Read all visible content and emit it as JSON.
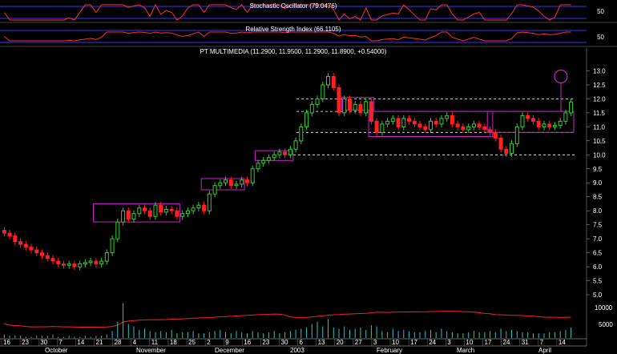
{
  "panels": {
    "stochastic": {
      "title": "Stochastic Oscillator (79.0476)",
      "label": "50",
      "line_color": "#ff3030",
      "band_color": "#3333ff"
    },
    "rsi": {
      "title": "Relative Strength Index (66.1105)",
      "label": "50",
      "line_color": "#ff3030",
      "band_color": "#3333ff"
    }
  },
  "chart_data": {
    "type": "candlestick",
    "title": "PT MULTIMEDIA (11.2900, 11.9500, 11.2900, 11.8900, +0.54000)",
    "ylim": [
      5.0,
      13.3
    ],
    "yticks": [
      "13.0",
      "12.5",
      "12.0",
      "11.5",
      "11.0",
      "10.5",
      "10.0",
      "9.5",
      "9.0",
      "8.5",
      "8.0",
      "7.5",
      "7.0",
      "6.5",
      "6.0",
      "5.5",
      "5.0"
    ],
    "colors": {
      "up": "#30d030",
      "down": "#ff2020",
      "grid": "#ffffff",
      "box": "#d020d0",
      "volume": "#20c8c8",
      "volume_ma": "#ff2020"
    },
    "closes": [
      7.2,
      7.1,
      6.9,
      6.8,
      6.7,
      6.6,
      6.5,
      6.4,
      6.3,
      6.2,
      6.1,
      6.05,
      6.1,
      6.0,
      6.1,
      6.15,
      6.2,
      6.1,
      6.2,
      6.5,
      7.0,
      7.6,
      8.0,
      7.7,
      7.9,
      8.1,
      8.0,
      7.8,
      8.2,
      7.95,
      8.05,
      8.0,
      7.8,
      7.9,
      8.0,
      8.1,
      8.2,
      8.0,
      8.6,
      8.9,
      9.0,
      9.1,
      8.9,
      8.95,
      9.1,
      9.0,
      9.5,
      9.7,
      9.8,
      9.9,
      10.0,
      10.1,
      10.0,
      10.2,
      10.5,
      11.0,
      11.5,
      11.8,
      12.0,
      12.5,
      12.8,
      12.4,
      11.5,
      12.0,
      11.6,
      11.8,
      11.5,
      11.9,
      11.2,
      10.8,
      11.1,
      11.2,
      11.3,
      11.0,
      11.3,
      11.2,
      11.1,
      11.0,
      10.9,
      11.2,
      11.1,
      11.3,
      11.4,
      11.1,
      11.0,
      10.9,
      11.0,
      11.1,
      11.0,
      10.9,
      10.8,
      10.6,
      10.2,
      10.05,
      10.4,
      11.0,
      11.4,
      11.3,
      11.2,
      11.0,
      11.1,
      11.0,
      11.05,
      11.2,
      11.5,
      11.89
    ],
    "volumes": [
      3,
      2,
      2,
      2,
      1,
      1,
      2,
      2,
      2,
      3,
      1,
      1,
      2,
      1,
      1,
      2,
      1,
      2,
      2,
      3,
      6,
      14,
      30,
      12,
      10,
      7,
      8,
      6,
      5,
      6,
      5,
      7,
      4,
      5,
      5,
      6,
      4,
      4,
      5,
      6,
      7,
      5,
      4,
      6,
      5,
      4,
      6,
      5,
      4,
      5,
      6,
      4,
      5,
      6,
      7,
      8,
      9,
      12,
      14,
      10,
      16,
      9,
      8,
      10,
      7,
      8,
      9,
      7,
      11,
      10,
      6,
      5,
      8,
      6,
      7,
      6,
      5,
      5,
      6,
      7,
      5,
      8,
      6,
      5,
      4,
      4,
      5,
      6,
      5,
      5,
      6,
      5,
      8,
      6,
      7,
      6,
      5,
      5,
      4,
      4,
      4,
      5,
      5,
      6,
      7,
      9
    ],
    "volume_labels": [
      "10000",
      "5000"
    ],
    "x_date_ticks": [
      "16",
      "23",
      "30",
      "7",
      "14",
      "21",
      "28",
      "4",
      "11",
      "18",
      "25",
      "2",
      "9",
      "16",
      "23",
      "30",
      "6",
      "13",
      "20",
      "27",
      "3",
      "10",
      "17",
      "24",
      "3",
      "10",
      "17",
      "24",
      "31",
      "7",
      "14"
    ],
    "x_month_labels": [
      "October",
      "November",
      "December",
      "2003",
      "February",
      "March",
      "April"
    ],
    "target_circle": 12.8,
    "levels": [
      12.0,
      11.55,
      10.8,
      10.0
    ]
  }
}
